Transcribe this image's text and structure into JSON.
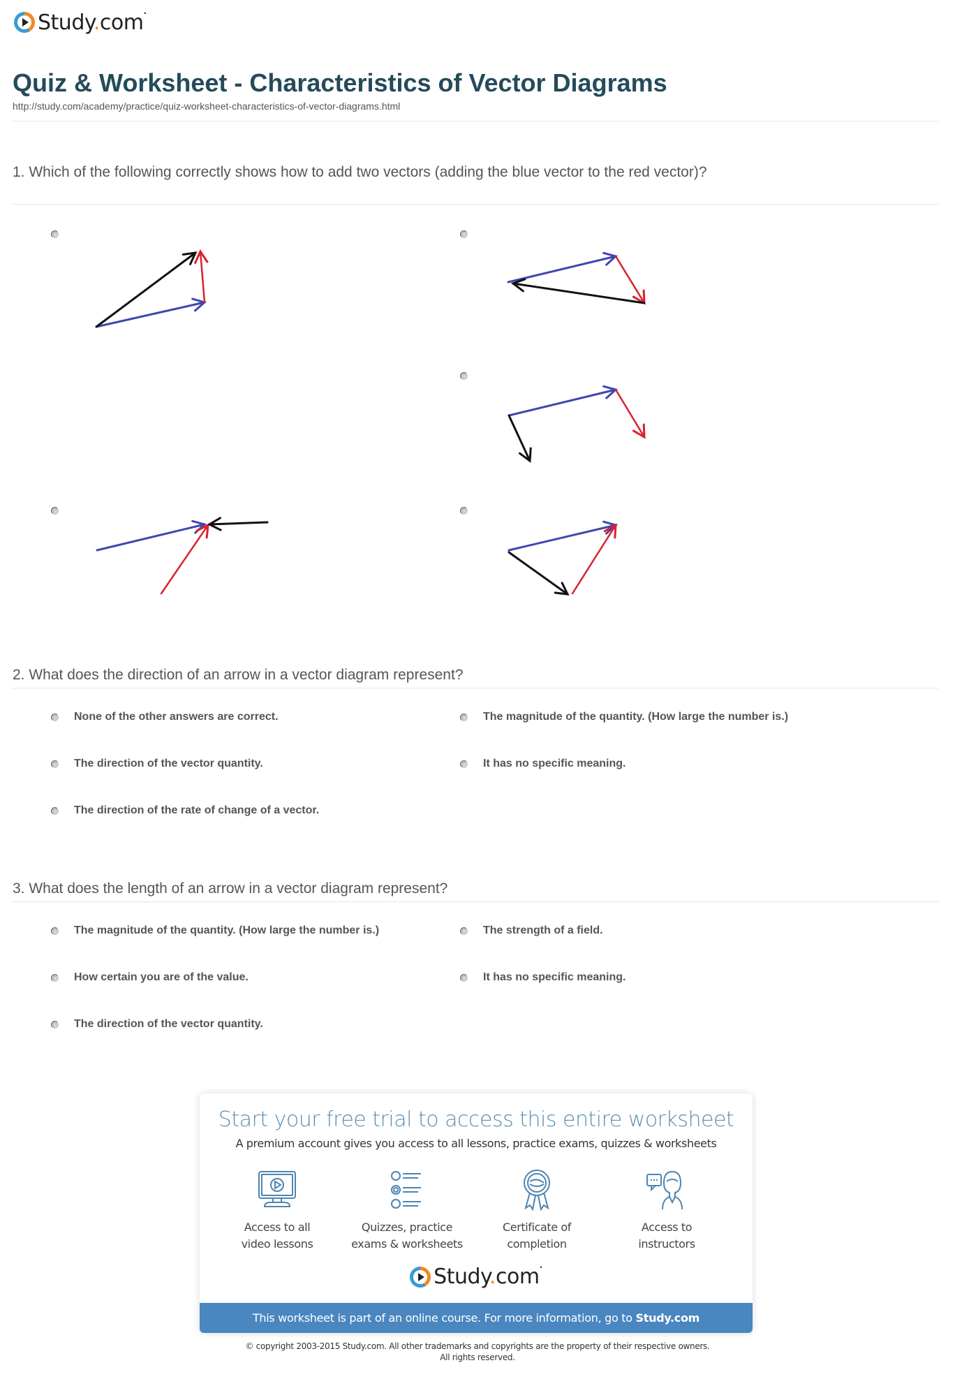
{
  "brand": {
    "name_part1": "Study",
    "name_dot": ".",
    "name_part2": "com",
    "tm": "•",
    "accent_orange": "#f08a24",
    "accent_blue": "#3a9bd5"
  },
  "header": {
    "title": "Quiz & Worksheet - Characteristics of Vector Diagrams",
    "url": "http://study.com/academy/practice/quiz-worksheet-characteristics-of-vector-diagrams.html"
  },
  "questions": [
    {
      "number": 1,
      "text": "1. Which of the following correctly shows how to add two vectors (adding the blue vector to the red vector)?",
      "options": [
        {
          "type": "diagram",
          "description": "blue vector then red vector, black resultant from blue tail to red head"
        },
        {
          "type": "diagram",
          "description": "blue then red, black arrow pointing back to blue tail"
        },
        {
          "type": "diagram",
          "description": "blue then red, black arrow pointing down from blue tail"
        },
        {
          "type": "diagram",
          "description": "blue and red heads meeting, black arrow pointing to them from right"
        },
        {
          "type": "diagram",
          "description": "blue and red heads meeting, black arrow from blue tail to red tail"
        }
      ]
    },
    {
      "number": 2,
      "text": "2. What does the direction of an arrow in a vector diagram represent?",
      "options": [
        "None of the other answers are correct.",
        "The magnitude of the quantity. (How large the number is.)",
        "The direction of the vector quantity.",
        "It has no specific meaning.",
        "The direction of the rate of change of a vector."
      ]
    },
    {
      "number": 3,
      "text": "3. What does the length of an arrow in a vector diagram represent?",
      "options": [
        "The magnitude of the quantity. (How large the number is.)",
        "The strength of a field.",
        "How certain you are of the value.",
        "It has no specific meaning.",
        "The direction of the vector quantity."
      ]
    }
  ],
  "vector_colors": {
    "blue": "#3f47b0",
    "red": "#d8222e",
    "black": "#111111"
  },
  "promo": {
    "title": "Start your free trial to access this entire worksheet",
    "subtitle": "A premium account gives you access to all lessons, practice exams, quizzes & worksheets",
    "features": [
      {
        "icon": "monitor-play-icon",
        "line1": "Access to all",
        "line2": "video lessons"
      },
      {
        "icon": "list-icon",
        "line1": "Quizzes, practice",
        "line2": "exams & worksheets"
      },
      {
        "icon": "award-ribbon-icon",
        "line1": "Certificate of",
        "line2": "completion"
      },
      {
        "icon": "instructor-chat-icon",
        "line1": "Access to",
        "line2": "instructors"
      }
    ],
    "banner_text": "This worksheet is part of an online course. For more information, go to ",
    "banner_link": "Study.com",
    "banner_color": "#4a86c0"
  },
  "footer": {
    "copyright_line1": "© copyright 2003-2015 Study.com. All other trademarks and copyrights are the property of their respective owners.",
    "copyright_line2": "All rights reserved."
  }
}
